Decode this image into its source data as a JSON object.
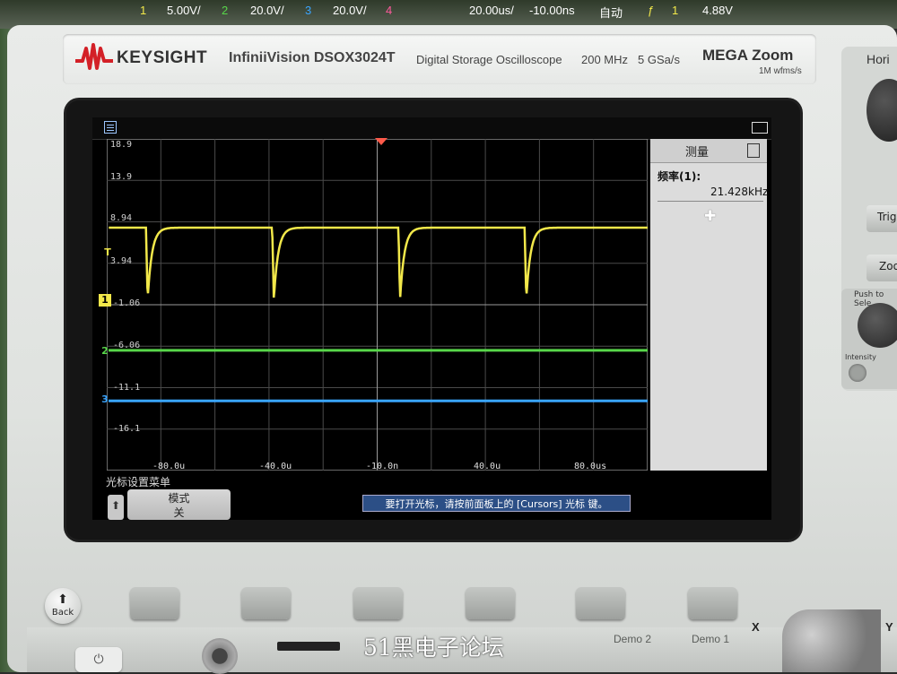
{
  "device": {
    "brand": "KEYSIGHT",
    "model": "InfiniiVision DSOX3024T",
    "description": "Digital Storage Oscilloscope",
    "bandwidth": "200 MHz",
    "sample_rate": "5 GSa/s",
    "megazoom_title": "MEGA Zoom",
    "megazoom_sub": "1M wfms/s"
  },
  "top_bar": {
    "ch1_num": "1",
    "ch1_scale": "5.00V/",
    "ch2_num": "2",
    "ch2_scale": "20.0V/",
    "ch3_num": "3",
    "ch3_scale": "20.0V/",
    "ch4_num": "4",
    "timebase": "20.00us/",
    "delay": "-10.00ns",
    "trigger_mode": "自动",
    "trigger_source": "1",
    "trigger_level": "4.88V"
  },
  "axis": {
    "v_labels": [
      "18.9",
      "13.9",
      "8.94",
      "3.94",
      "-1.06",
      "-6.06",
      "-11.1",
      "-16.1"
    ],
    "t_labels": [
      "-80.0u",
      "-40.0u",
      "-10.0n",
      "40.0u",
      "80.0us"
    ]
  },
  "channel_markers": {
    "ch1": "1",
    "ch2": "2",
    "ch3": "3",
    "trigger": "T"
  },
  "measure_panel": {
    "title": "测量",
    "label": "频率(1):",
    "value": "21.428kHz"
  },
  "bottom_bar": {
    "menu_title": "光标设置菜单",
    "mode_label": "模式",
    "mode_value": "关",
    "message": "要打开光标，请按前面板上的 [Cursors] 光标 键。"
  },
  "front_panel": {
    "back_label": "Back",
    "horiz_label": "Hori",
    "trig_label": "Trig",
    "zoom_label": "Zoo",
    "push_select": "Push to Sele",
    "intensity": "Intensity",
    "demo2": "Demo 2",
    "demo1": "Demo 1",
    "x_label": "X",
    "y_label": "Y"
  },
  "watermark": "51黑电子论坛",
  "colors": {
    "ch1": "#f2e84a",
    "ch2": "#58d64a",
    "ch3": "#3aa5ff",
    "ch4": "#ff5a9c"
  },
  "signal": {
    "ch1_frequency_khz": 21.428,
    "ch1_high_v": 8.2,
    "ch1_low_v": -0.5,
    "ch2_level_v": -6.6,
    "ch3_level_v": -12.7
  }
}
